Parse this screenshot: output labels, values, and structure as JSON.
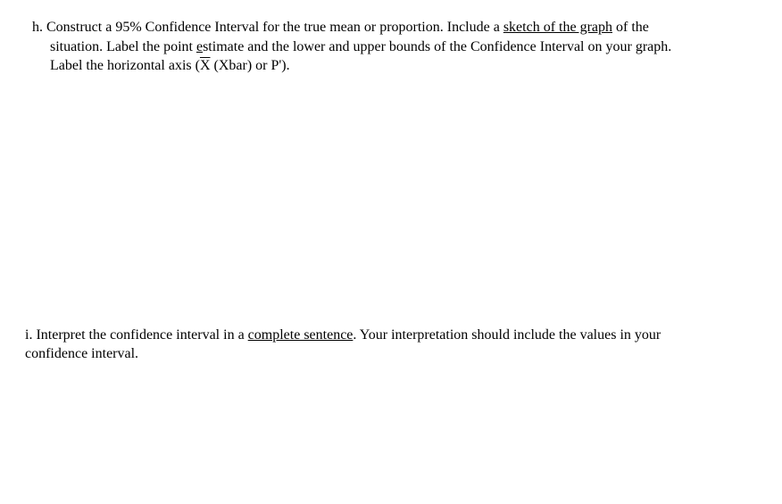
{
  "question_h": {
    "label": "h.",
    "text_1a": "Construct a 95% Confidence Interval for the true mean or proportion.   Include a ",
    "text_1b_underlined": "sketch of the graph",
    "text_1c": " of the",
    "text_2a": "situation.  Label the point ",
    "text_2b_underlined": "e",
    "text_2c": "stimate and the lower and upper bounds of the Confidence Interval on your graph.",
    "text_3a": "Label the horizontal axis (",
    "text_3b_overline": "X",
    "text_3c": " (Xbar) or P')."
  },
  "question_i": {
    "text_1a": "i. Interpret the confidence interval in a ",
    "text_1b_underlined": "complete sentence",
    "text_1c": ". Your interpretation should include the values in your",
    "text_2": "confidence interval."
  }
}
